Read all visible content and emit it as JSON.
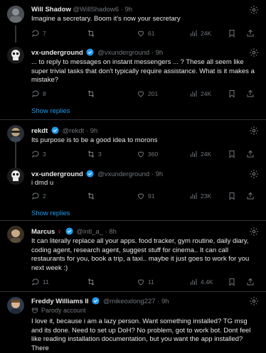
{
  "colors": {
    "background": "#000000",
    "text": "#e7e9ea",
    "muted": "#71767b",
    "link": "#1d9bf0",
    "verified": "#1d9bf0",
    "divider": "#2f3336"
  },
  "tweets": [
    {
      "name": "Will Shadow",
      "handle": "@WillShadow6",
      "time": "· 9h",
      "text": "Imagine a secretary. Boom it's now your secretary",
      "replies": "7",
      "reposts": "",
      "likes": "61",
      "views": "24K"
    },
    {
      "name": "vx-underground",
      "handle": "@vxunderground",
      "time": "· 9h",
      "text": "... to reply to messages on instant messengers ... ? These all seem like super trivial tasks that don't typically require assistance. What is it makes a mistake?",
      "replies": "8",
      "reposts": "",
      "likes": "201",
      "views": "24K",
      "show_replies": "Show replies"
    },
    {
      "name": "rekdt",
      "handle": "@rekdt",
      "time": "· 9h",
      "text": "Its purpose is to be a good idea to morons",
      "replies": "3",
      "reposts": "3",
      "likes": "360",
      "views": "24K"
    },
    {
      "name": "vx-underground",
      "handle": "@vxunderground",
      "time": "· 9h",
      "text": "i dmd u",
      "replies": "2",
      "reposts": "",
      "likes": "91",
      "views": "23K",
      "show_replies": "Show replies"
    },
    {
      "name": "Marcus",
      "handle": "@intl_a_",
      "time": "· 8h",
      "text": "It can literally replace all your apps. food tracker, gym routine, daily diary, coding agent, research agent, suggest stuff for cinema.. It can call restaurants for you, book a trip, a taxi.. maybe it just goes to work for you next week :)",
      "replies": "11",
      "reposts": "",
      "likes": "11",
      "views": "4.4K"
    },
    {
      "name": "Freddy Williams II",
      "handle": "@mikeoxlong227",
      "time": "· 9h",
      "parody": "Parody account",
      "text": "I love it, because i am a lazy person. Want something installed? TG msg and its done. Need to set up DoH? No problem, got to work bot. Dont feel like reading installation documentation, but you want the app installed? There"
    }
  ]
}
